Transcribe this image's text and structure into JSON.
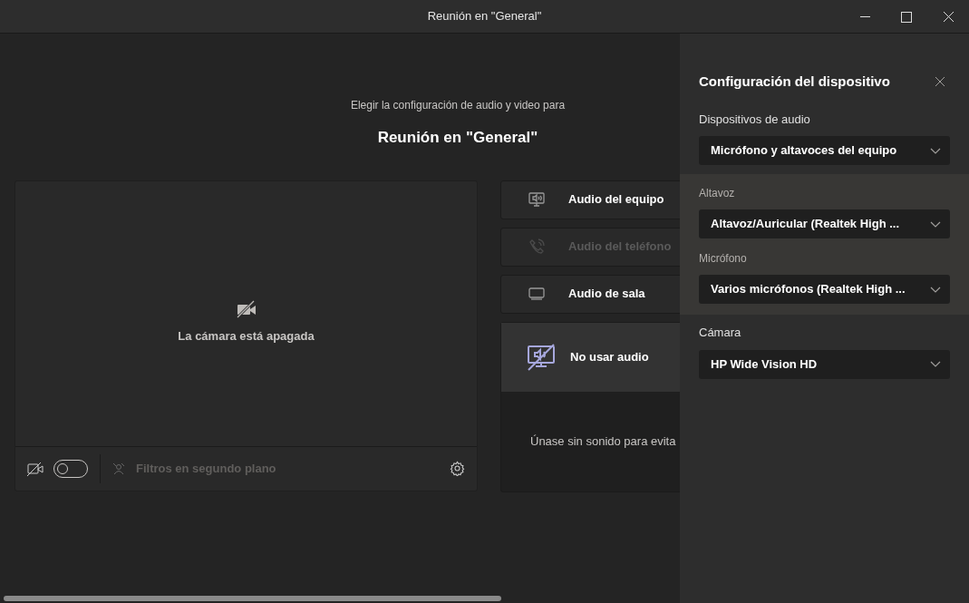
{
  "window": {
    "title": "Reunión en \"General\""
  },
  "prejoin": {
    "subtitle": "Elegir la configuración de audio y video para",
    "meeting_title": "Reunión en \"General\""
  },
  "video_preview": {
    "status_text": "La cámara está apagada",
    "camera_toggle": {
      "on": false
    },
    "background_filters": {
      "label": "Filtros en segundo plano",
      "disabled": true
    }
  },
  "audio_options": [
    {
      "kind": "computer",
      "label": "Audio del equipo",
      "selected": false,
      "disabled": false
    },
    {
      "kind": "phone",
      "label": "Audio del teléfono",
      "selected": false,
      "disabled": true
    },
    {
      "kind": "room",
      "label": "Audio de sala",
      "selected": false,
      "disabled": false
    },
    {
      "kind": "none",
      "label": "No usar audio",
      "selected": true,
      "disabled": false,
      "description": "Únase sin sonido para evita"
    }
  ],
  "device_settings": {
    "title": "Configuración del dispositivo",
    "sections": [
      {
        "highlighted": false,
        "fields": [
          {
            "label": "Dispositivos de audio",
            "value": "Micrófono y altavoces del equipo"
          }
        ]
      },
      {
        "highlighted": true,
        "fields": [
          {
            "label": "Altavoz",
            "value": "Altavoz/Auricular (Realtek High ..."
          },
          {
            "label": "Micrófono",
            "value": "Varios micrófonos (Realtek High ..."
          }
        ]
      },
      {
        "highlighted": false,
        "fields": [
          {
            "label": "Cámara",
            "value": "HP Wide Vision HD"
          }
        ]
      }
    ]
  }
}
